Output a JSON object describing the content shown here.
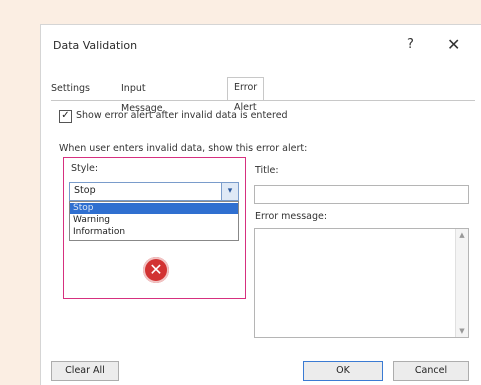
{
  "dialog": {
    "title": "Data Validation",
    "help_glyph": "?",
    "close_glyph": "✕"
  },
  "tabs": [
    {
      "label": "Settings"
    },
    {
      "label": "Input Message"
    },
    {
      "label": "Error Alert",
      "active": true
    }
  ],
  "error_alert": {
    "show_alert_label": "Show error alert after invalid data is entered",
    "show_alert_checked": true,
    "when_text": "When user enters invalid data, show this error alert:",
    "style_label": "Style:",
    "style_value": "Stop",
    "style_options": [
      "Stop",
      "Warning",
      "Information"
    ],
    "title_label": "Title:",
    "title_value": "",
    "message_label": "Error message:",
    "message_value": ""
  },
  "footer": {
    "clear_all": "Clear All",
    "ok": "OK",
    "cancel": "Cancel"
  },
  "colors": {
    "highlight": "#d6307f",
    "selected_option": "#2f6fd0",
    "error_icon": "#d23232"
  },
  "icons": {
    "check": "✓",
    "dropdown": "▾",
    "error": "✕"
  }
}
